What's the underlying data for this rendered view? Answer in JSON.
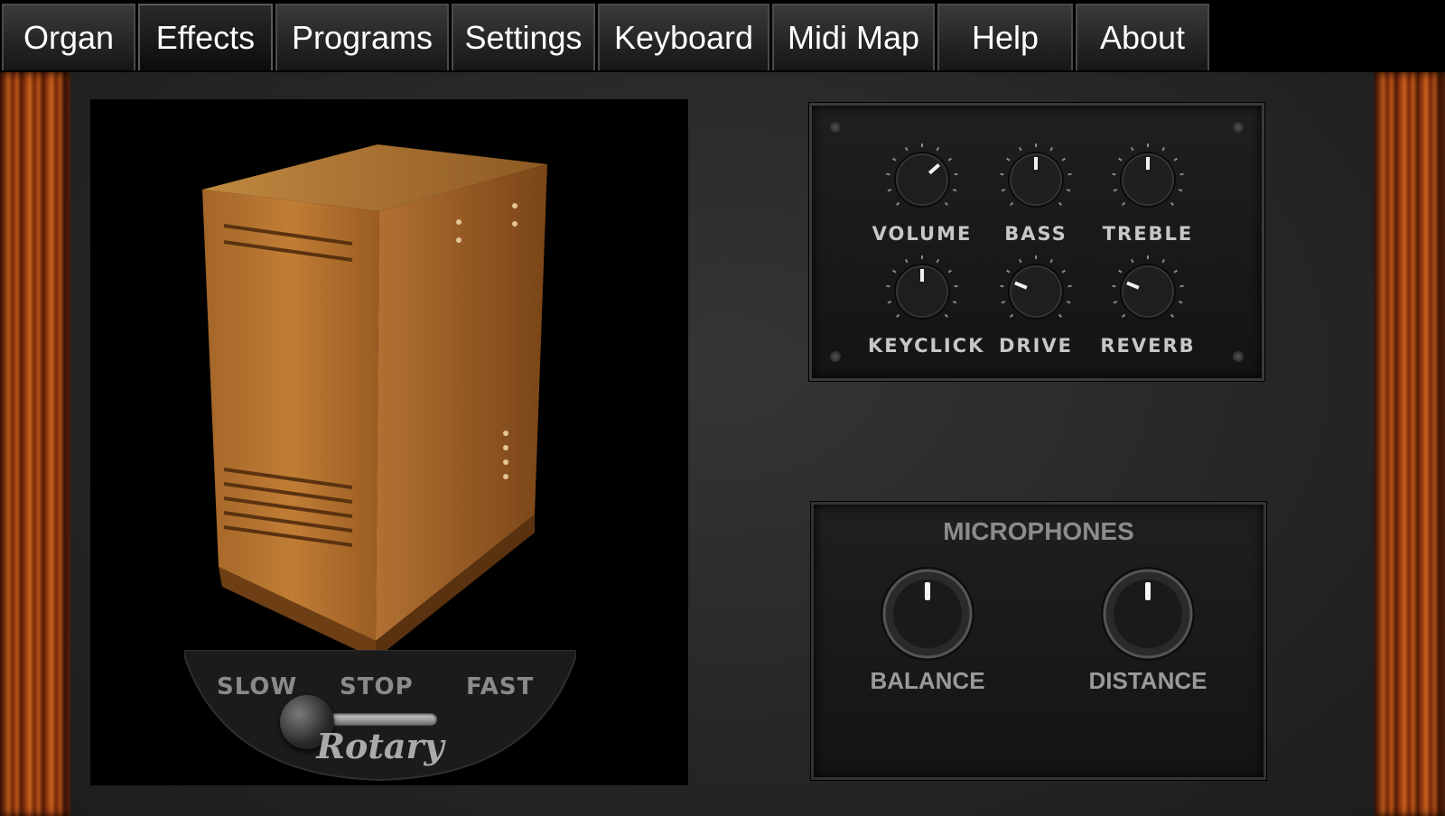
{
  "tabs": [
    {
      "label": "Organ",
      "active": false
    },
    {
      "label": "Effects",
      "active": true
    },
    {
      "label": "Programs",
      "active": false
    },
    {
      "label": "Settings",
      "active": false
    },
    {
      "label": "Keyboard",
      "active": false
    },
    {
      "label": "Midi Map",
      "active": false
    },
    {
      "label": "Help",
      "active": false
    },
    {
      "label": "About",
      "active": false
    }
  ],
  "rotary": {
    "slow_label": "SLOW",
    "stop_label": "STOP",
    "fast_label": "FAST",
    "title": "Rotary",
    "selected": "SLOW"
  },
  "tone_knobs": [
    {
      "label": "VOLUME",
      "level": 0.68
    },
    {
      "label": "BASS",
      "level": 0.5
    },
    {
      "label": "TREBLE",
      "level": 0.5
    },
    {
      "label": "KEYCLICK",
      "level": 0.5
    },
    {
      "label": "DRIVE",
      "level": 0.25
    },
    {
      "label": "REVERB",
      "level": 0.25
    }
  ],
  "microphones": {
    "title": "MICROPHONES",
    "knobs": [
      {
        "label": "BALANCE",
        "level": 0.5
      },
      {
        "label": "DISTANCE",
        "level": 0.5
      }
    ]
  }
}
